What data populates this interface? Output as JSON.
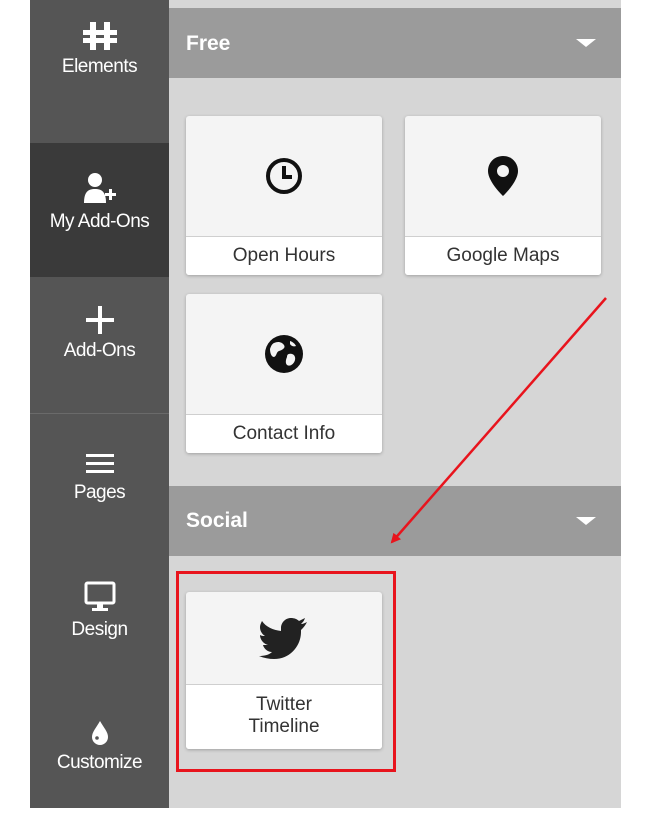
{
  "sidebar": {
    "items": [
      {
        "label": "Elements",
        "icon": "elements-icon"
      },
      {
        "label": "My Add-Ons",
        "icon": "add-user-icon",
        "active": true
      },
      {
        "label": "Add-Ons",
        "icon": "plus-icon"
      },
      {
        "label": "Pages",
        "icon": "hamburger-icon"
      },
      {
        "label": "Design",
        "icon": "monitor-icon"
      },
      {
        "label": "Customize",
        "icon": "droplet-icon"
      }
    ]
  },
  "sections": {
    "free": {
      "title": "Free",
      "cards": [
        {
          "label": "Open Hours",
          "icon": "clock-icon"
        },
        {
          "label": "Google Maps",
          "icon": "map-pin-icon"
        },
        {
          "label": "Contact Info",
          "icon": "globe-icon"
        }
      ]
    },
    "social": {
      "title": "Social",
      "cards": [
        {
          "label_line1": "Twitter",
          "label_line2": "Timeline",
          "icon": "twitter-bird-icon"
        }
      ]
    }
  },
  "annotation": {
    "arrow_color": "#e8141d",
    "box_color": "#e8141d"
  },
  "colors": {
    "sidebar": "#555555",
    "sidebar_active": "#3a3a3a",
    "header": "#9b9b9b",
    "panel": "#d6d6d6"
  }
}
